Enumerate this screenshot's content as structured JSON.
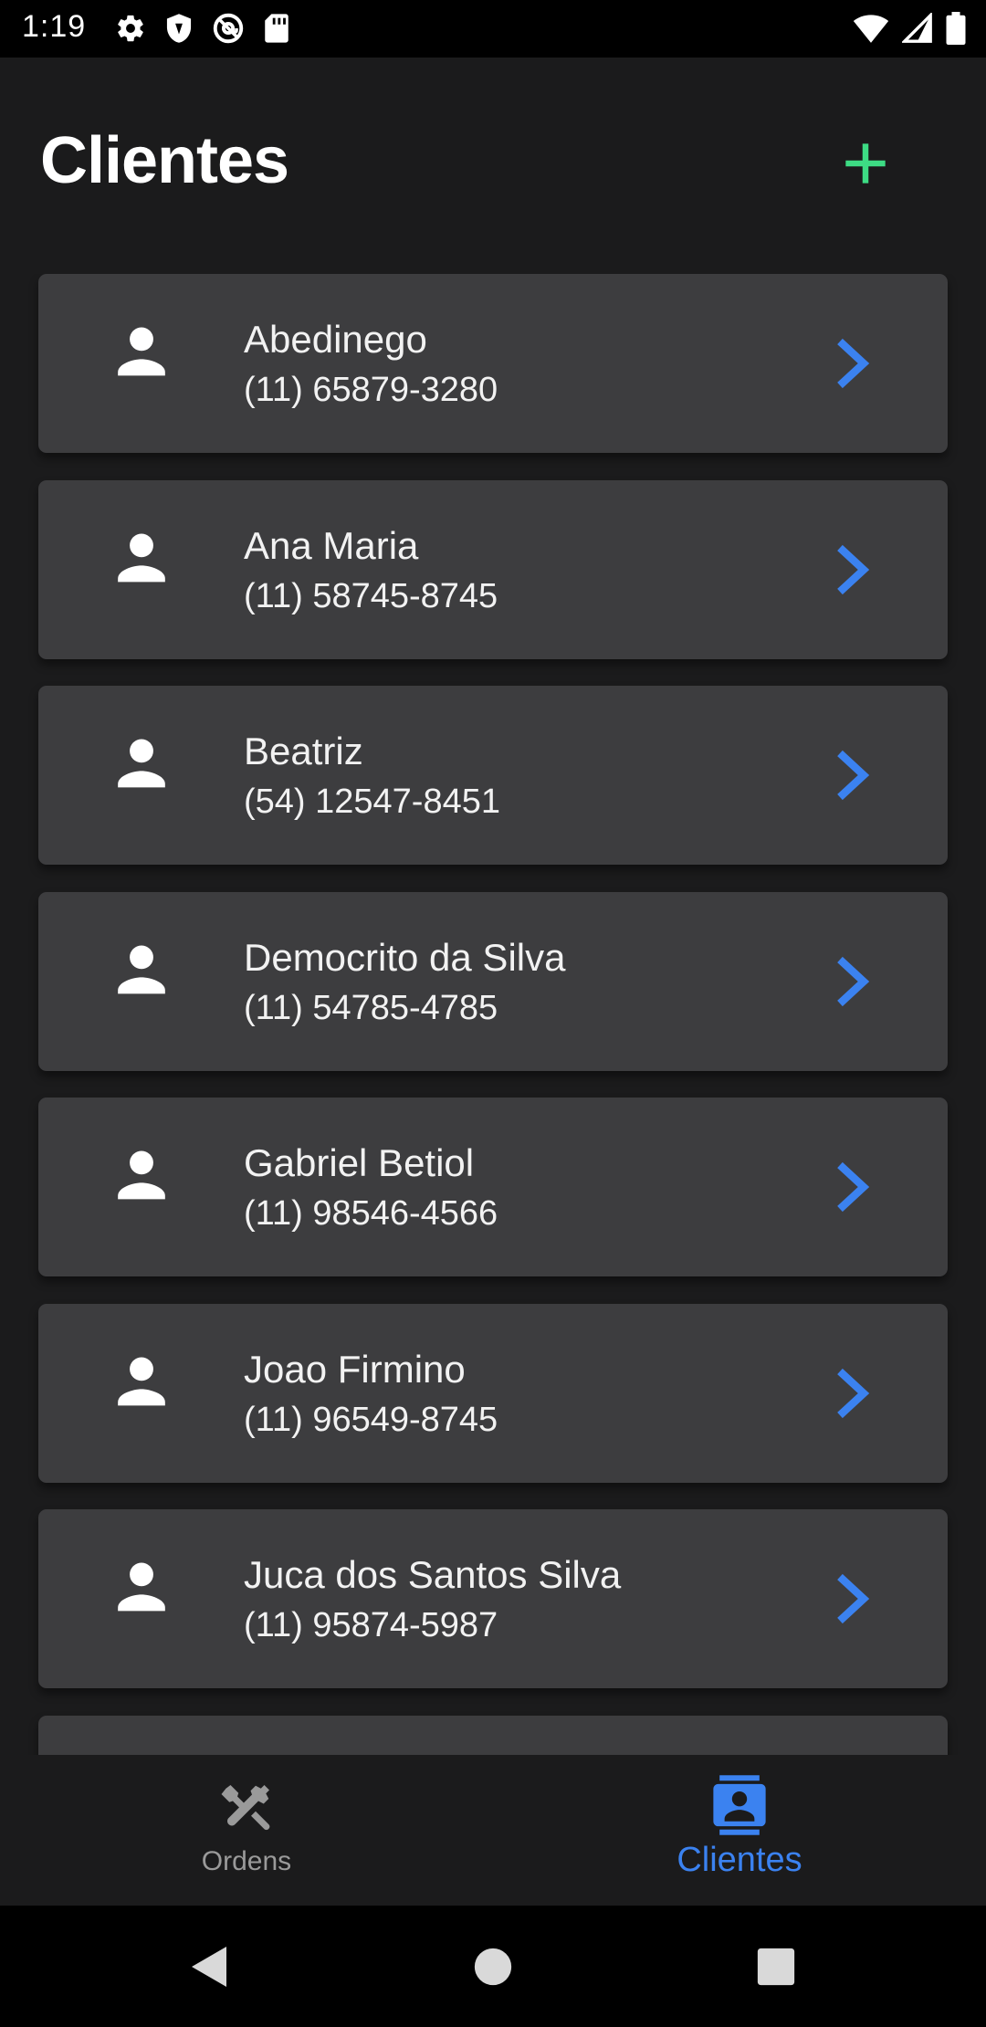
{
  "status_bar": {
    "time": "1:19",
    "left_icons": [
      "gear-icon",
      "shield-icon",
      "at-sign-icon",
      "sd-card-icon"
    ],
    "right_icons": [
      "wifi-icon",
      "cell-signal-icon",
      "battery-icon"
    ]
  },
  "header": {
    "title": "Clientes",
    "add_icon": "plus-icon",
    "add_color": "#3ddc84"
  },
  "clients": [
    {
      "name": "Abedinego",
      "phone": "(11) 65879-3280"
    },
    {
      "name": "Ana Maria",
      "phone": "(11) 58745-8745"
    },
    {
      "name": "Beatriz",
      "phone": "(54) 12547-8451"
    },
    {
      "name": "Democrito da Silva",
      "phone": "(11) 54785-4785"
    },
    {
      "name": "Gabriel Betiol",
      "phone": "(11) 98546-4566"
    },
    {
      "name": "Joao Firmino",
      "phone": "(11) 96549-8745"
    },
    {
      "name": "Juca dos Santos Silva",
      "phone": "(11) 95874-5987"
    }
  ],
  "colors": {
    "accent": "#3b82f0",
    "card": "#3d3d3f",
    "background": "#1b1b1c"
  },
  "bottom_nav": {
    "items": [
      {
        "label": "Ordens",
        "icon": "tools-icon",
        "active": false
      },
      {
        "label": "Clientes",
        "icon": "contact-card-icon",
        "active": true
      }
    ]
  },
  "system_nav": [
    "back-icon",
    "home-icon",
    "recents-icon"
  ]
}
